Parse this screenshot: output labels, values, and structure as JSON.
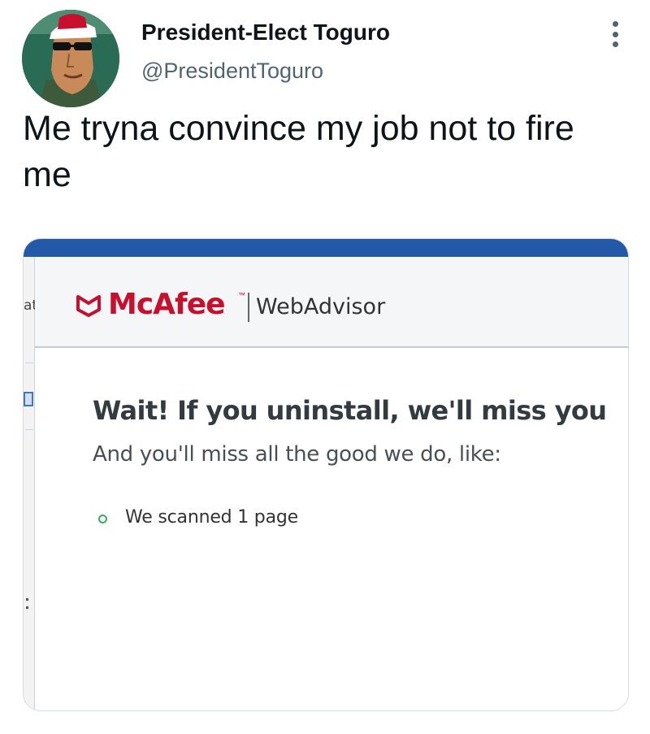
{
  "tweet": {
    "display_name": "President-Elect Toguro",
    "handle": "@PresidentToguro",
    "text": "Me tryna convince my job not to fire me",
    "avatar_icon": "avatar-image",
    "more_icon": "more-options-icon"
  },
  "media": {
    "side_fragment_top": "at",
    "brand": "McAfee",
    "brand_tm": "™",
    "product": "WebAdvisor",
    "headline": "Wait! If you uninstall, we'll miss you",
    "subhead": "And you'll miss all the good we do, like:",
    "benefits": [
      {
        "text": "We scanned 1 page"
      }
    ]
  },
  "colors": {
    "brand_red": "#c8102e",
    "bar_blue": "#2458a8",
    "bullet_green": "#3aa865",
    "handle_gray": "#536471"
  }
}
